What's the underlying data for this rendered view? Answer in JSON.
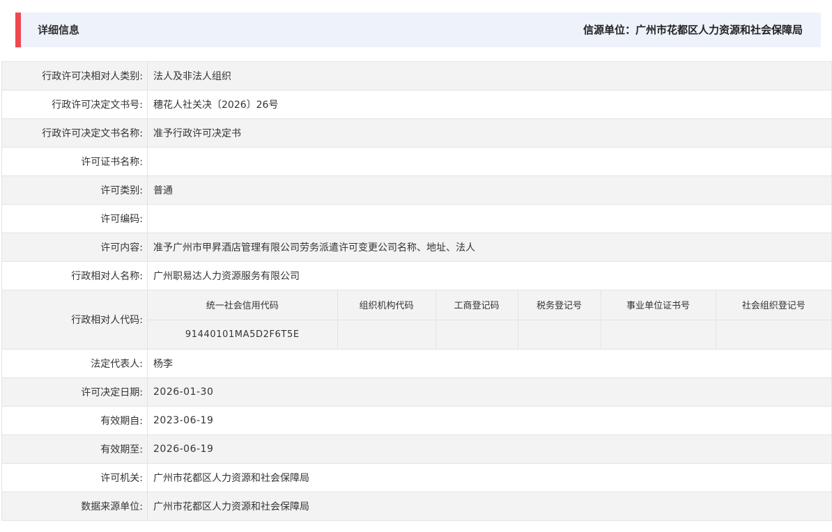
{
  "header": {
    "title": "详细信息",
    "source": "信源单位：广州市花都区人力资源和社会保障局"
  },
  "rows": [
    {
      "label": "行政许可决相对人类别:",
      "value": "法人及非法人组织"
    },
    {
      "label": "行政许可决定文书号:",
      "value": "穗花人社关决〔2026〕26号"
    },
    {
      "label": "行政许可决定文书名称:",
      "value": "准予行政许可决定书"
    },
    {
      "label": "许可证书名称:",
      "value": ""
    },
    {
      "label": "许可类别:",
      "value": "普通"
    },
    {
      "label": "许可编码:",
      "value": ""
    },
    {
      "label": "许可内容:",
      "value": "准予广州市甲昇酒店管理有限公司劳务派遣许可变更公司名称、地址、法人"
    },
    {
      "label": "行政相对人名称:",
      "value": "广州职易达人力资源服务有限公司"
    }
  ],
  "codes": {
    "label": "行政相对人代码:",
    "headers": [
      "统一社会信用代码",
      "组织机构代码",
      "工商登记码",
      "税务登记号",
      "事业单位证书号",
      "社会组织登记号"
    ],
    "values": [
      "91440101MA5D2F6T5E",
      "",
      "",
      "",
      "",
      ""
    ]
  },
  "rows2": [
    {
      "label": "法定代表人:",
      "value": "杨李"
    },
    {
      "label": "许可决定日期:",
      "value": "2026-01-30"
    },
    {
      "label": "有效期自:",
      "value": "2023-06-19"
    },
    {
      "label": "有效期至:",
      "value": "2026-06-19"
    },
    {
      "label": "许可机关:",
      "value": "广州市花都区人力资源和社会保障局"
    },
    {
      "label": "数据来源单位:",
      "value": "广州市花都区人力资源和社会保障局"
    }
  ],
  "colors": {
    "accent": "#f0484e",
    "header_bg": "#eef3fb",
    "row_alt_bg": "#f3f3f3",
    "border": "#e3e3e3"
  }
}
